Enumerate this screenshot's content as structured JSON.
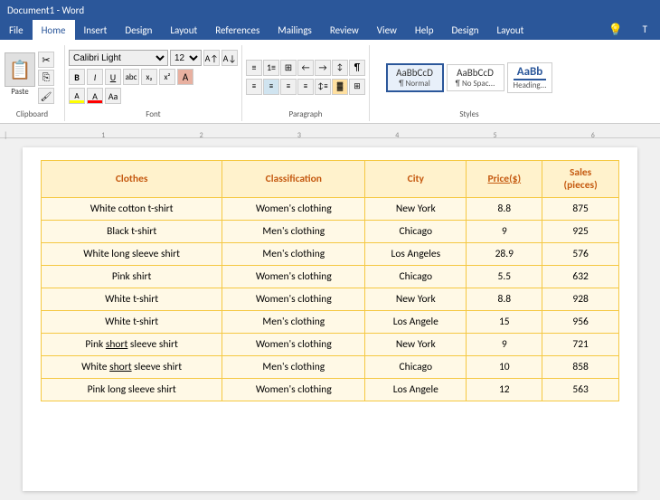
{
  "titlebar": {
    "text": "Document1 - Word"
  },
  "menubar": {
    "items": [
      "File",
      "Home",
      "Insert",
      "Design",
      "Layout",
      "References",
      "Mailings",
      "Review",
      "View",
      "Help",
      "Design",
      "Layout"
    ],
    "active": "Home"
  },
  "ribbon": {
    "font_name": "Calibri Light",
    "font_size": "12",
    "clipboard_label": "Clipboard",
    "font_label": "Font",
    "paragraph_label": "Paragraph",
    "styles_label": "Styles",
    "paste_label": "Paste",
    "cut_label": "✂",
    "copy_label": "⎘",
    "format_painter_label": "🖌",
    "bold_label": "B",
    "italic_label": "I",
    "underline_label": "U",
    "styles": [
      {
        "name": "Normal",
        "label": "AaBbCcD",
        "sub": "¶ Normal"
      },
      {
        "name": "NoSpacing",
        "label": "AaBbCcD",
        "sub": "¶ No Spac..."
      },
      {
        "name": "Heading1",
        "label": "AaBb",
        "sub": "Heading..."
      }
    ]
  },
  "table": {
    "headers": [
      "Clothes",
      "Classification",
      "City",
      "Price($)",
      "Sales\n(pieces)"
    ],
    "rows": [
      {
        "clothes": "White cotton t-shirt",
        "classification": "Women's clothing",
        "city": "New York",
        "price": "8.8",
        "sales": "875"
      },
      {
        "clothes": "Black t-shirt",
        "classification": "Men's clothing",
        "city": "Chicago",
        "price": "9",
        "sales": "925"
      },
      {
        "clothes": "White long sleeve shirt",
        "classification": "Men's clothing",
        "city": "Los Angeles",
        "price": "28.9",
        "sales": "576"
      },
      {
        "clothes": "Pink shirt",
        "classification": "Women's clothing",
        "city": "Chicago",
        "price": "5.5",
        "sales": "632"
      },
      {
        "clothes": "White t-shirt",
        "classification": "Women's clothing",
        "city": "New York",
        "price": "8.8",
        "sales": "928"
      },
      {
        "clothes": "White t-shirt",
        "classification": "Men's clothing",
        "city": "Los Angele",
        "price": "15",
        "sales": "956"
      },
      {
        "clothes": "Pink short sleeve shirt",
        "classification": "Women's clothing",
        "city": "New York",
        "price": "9",
        "sales": "721"
      },
      {
        "clothes": "White short sleeve shirt",
        "classification": "Men's clothing",
        "city": "Chicago",
        "price": "10",
        "sales": "858"
      },
      {
        "clothes": "Pink long sleeve shirt",
        "classification": "Women's clothing",
        "city": "Los Angele",
        "price": "12",
        "sales": "563"
      }
    ]
  }
}
